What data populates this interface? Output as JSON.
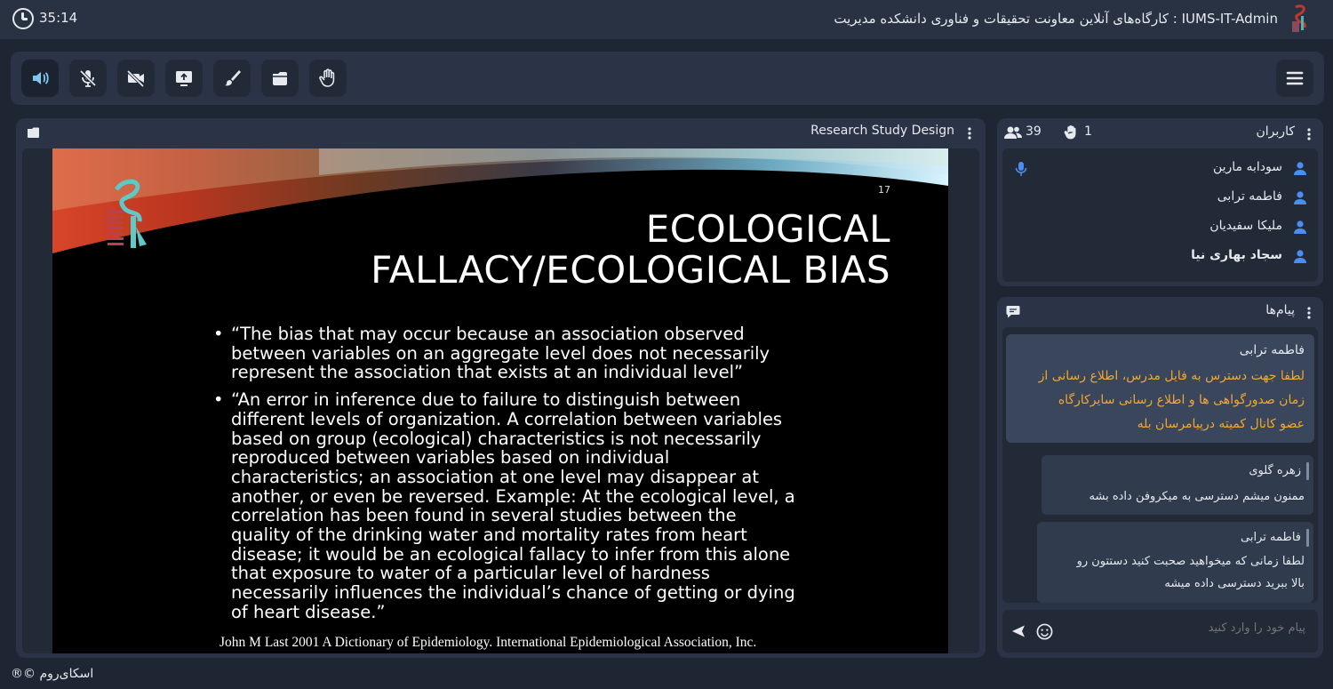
{
  "topbar": {
    "timer": "35:14",
    "room_title": "IUMS-IT-Admin : کارگاه‌های آنلاین معاونت تحقیقات و فناوری دانشکده مدیریت"
  },
  "presentation": {
    "title": "Research Study Design",
    "slide": {
      "number": "17",
      "heading_line1": "ECOLOGICAL",
      "heading_line2": "FALLACY/ECOLOGICAL BIAS",
      "bullets": [
        "“The bias that may occur because an association observed between variables on an aggregate level does not necessarily represent the association that exists at an individual level”",
        "“An error in inference due to failure to distinguish between different levels of organization.  A correlation between variables based on group (ecological) characteristics is not necessarily reproduced between variables based on individual characteristics; an association at one level may disappear at another, or even be reversed.  Example: At the ecological level, a correlation has been found in several studies between the quality of the drinking water and mortality rates from heart disease; it would be an ecological fallacy to infer from this alone that exposure to water of a particular level of hardness necessarily influences the individual’s chance of getting or dying of heart disease.”"
      ],
      "citation": "John M Last 2001 A Dictionary of Epidemiology.  International Epidemiological Association, Inc."
    }
  },
  "users": {
    "title": "کاربران",
    "raised_hands": "1",
    "count": "39",
    "list": [
      {
        "name": "سودابه مارین",
        "mic": true
      },
      {
        "name": "فاطمه ترابی",
        "mic": false
      },
      {
        "name": "ملیکا سفیدیان",
        "mic": false
      },
      {
        "name": "سجاد بهاری نیا",
        "mic": false
      }
    ]
  },
  "chat": {
    "title": "پیام‌ها",
    "messages": [
      {
        "author": "فاطمه ترابی",
        "lines": [
          "لطفا جهت دسترس به فایل مدرس، اطلاع رسانی از",
          "زمان صدورگواهی ها و اطلاع رسانی سایرکارگاه",
          "عضو کانال کمیته درپیامرسان بله"
        ]
      },
      {
        "author": "زهره گلوی",
        "lines": [
          "ممنون میشم دسترسی به میکروفن داده بشه"
        ]
      },
      {
        "author": "فاطمه ترابی",
        "lines": [
          "لطفا زمانی که میخواهید صحبت کنید دستتون رو",
          "بالا ببرید دسترسی داده میشه"
        ]
      }
    ],
    "input_placeholder": "پیام خود را وارد کنید"
  },
  "footer": "اسکای‌روم ©®",
  "colors": {
    "background": "#1e2633",
    "panel": "#2b3446",
    "panel_inner": "#222a38",
    "highlight_text": "#f0a830",
    "user_icon": "#4c8cf5"
  }
}
